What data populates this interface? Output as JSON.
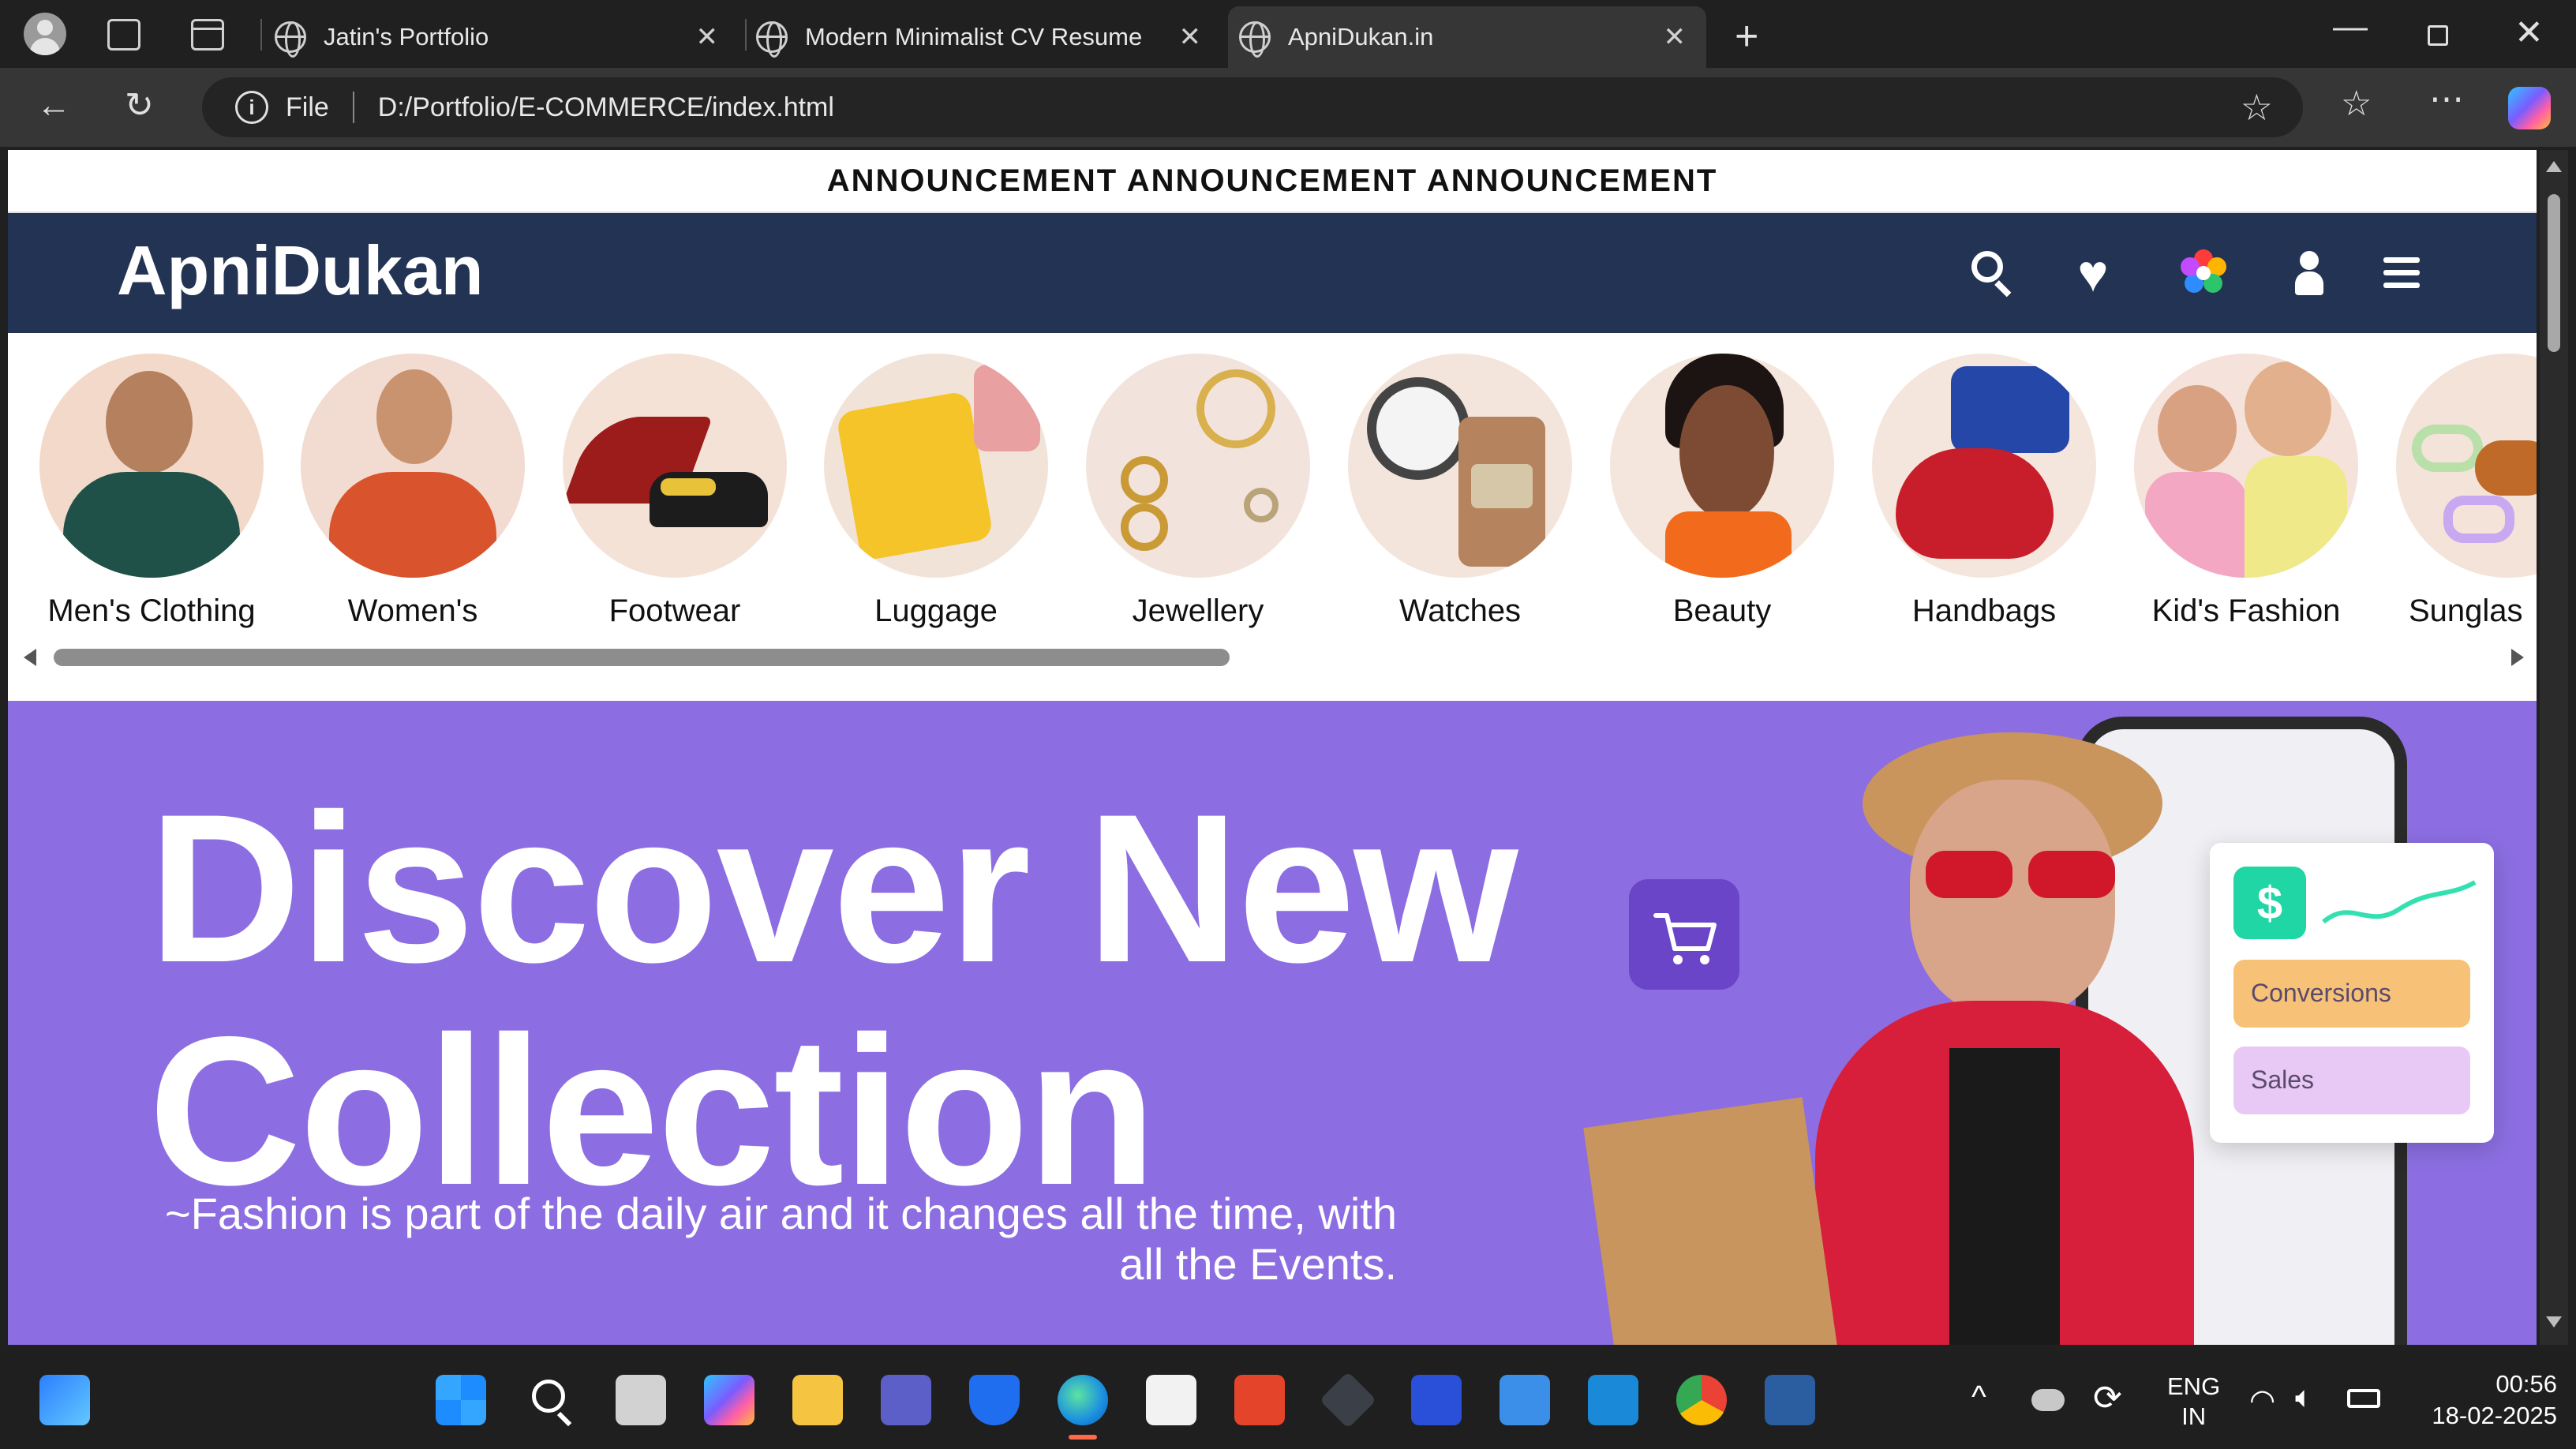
{
  "browser": {
    "tabs": [
      {
        "title": "Jatin's Portfolio",
        "active": false
      },
      {
        "title": "Modern Minimalist CV Resume",
        "active": false
      },
      {
        "title": "ApniDukan.in",
        "active": true
      }
    ],
    "address_scheme": "File",
    "address_url": "D:/Portfolio/E-COMMERCE/index.html"
  },
  "page": {
    "announcement": "ANNOUNCEMENT ANNOUNCEMENT ANNOUNCEMENT",
    "logo": "ApniDukan",
    "header_icons": [
      "search-icon",
      "heart-icon",
      "flower-icon",
      "user-icon",
      "menu-icon"
    ],
    "categories": [
      {
        "label": "Men's Clothing",
        "color": "#f3d9c9"
      },
      {
        "label": "Women's",
        "color": "#f2dbd0"
      },
      {
        "label": "Footwear",
        "color": "#f4e2d7"
      },
      {
        "label": "Luggage",
        "color": "#f2e3d8"
      },
      {
        "label": "Jewellery",
        "color": "#f2e4dc"
      },
      {
        "label": "Watches",
        "color": "#f3e5dc"
      },
      {
        "label": "Beauty",
        "color": "#f4e6dd"
      },
      {
        "label": "Handbags",
        "color": "#f4e6dd"
      },
      {
        "label": "Kid's Fashion",
        "color": "#f5e2da"
      },
      {
        "label": "Sunglas",
        "color": "#f3e3d9"
      }
    ],
    "hero": {
      "title_line1": "Discover New",
      "title_line2": "Collection",
      "tagline": "~Fashion is part of the daily air and it changes all the time, with all the Events.",
      "card_labels": [
        "Conversions",
        "Sales"
      ],
      "currency_symbol": "$"
    }
  },
  "taskbar": {
    "lang_line1": "ENG",
    "lang_line2": "IN",
    "time": "00:56",
    "date": "18-02-2025"
  },
  "colors": {
    "header_bg": "#233353",
    "hero_bg": "#8c6ee2",
    "chrome_bg": "#202020"
  }
}
